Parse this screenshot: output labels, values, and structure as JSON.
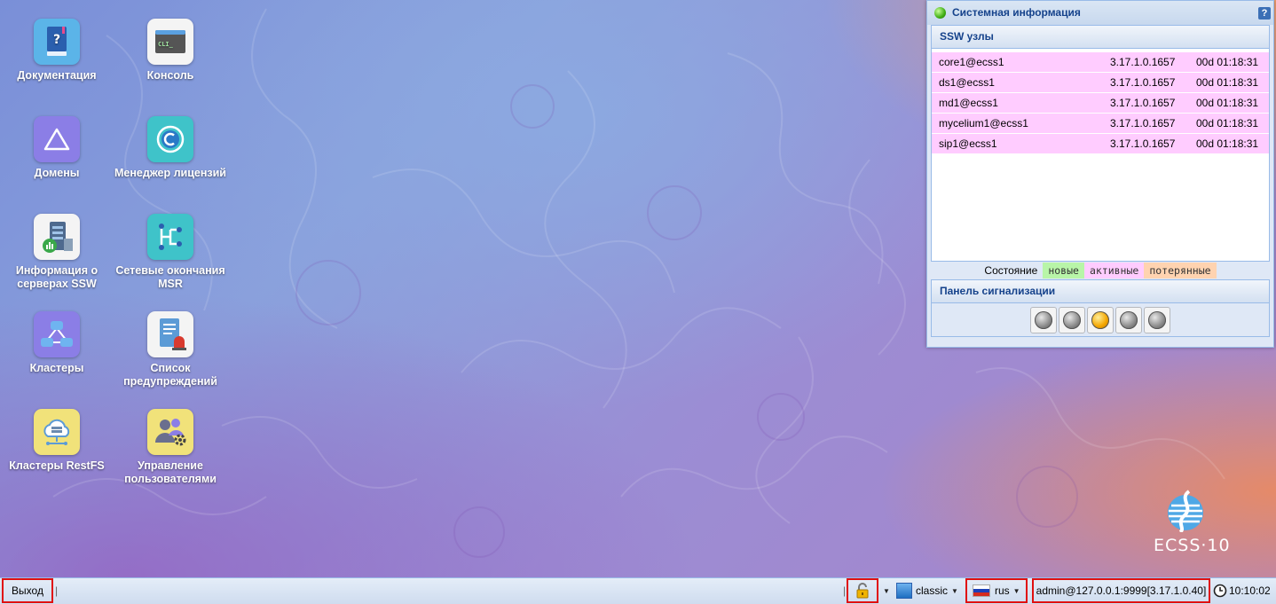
{
  "desktop_icons": [
    {
      "id": "docs",
      "label": "Документация",
      "icon": "book-help-icon"
    },
    {
      "id": "console",
      "label": "Консоль",
      "icon": "cli-console-icon"
    },
    {
      "id": "domains",
      "label": "Домены",
      "icon": "triangle-icon"
    },
    {
      "id": "license",
      "label": "Менеджер лицензий",
      "icon": "copyright-icon"
    },
    {
      "id": "serverinfo",
      "label": "Информация о серверах SSW",
      "icon": "server-stats-icon"
    },
    {
      "id": "msr",
      "label": "Сетевые окончания MSR",
      "icon": "network-endpoints-icon"
    },
    {
      "id": "clusters",
      "label": "Кластеры",
      "icon": "cluster-icon"
    },
    {
      "id": "alerts",
      "label": "Список предупреждений",
      "icon": "alarm-list-icon"
    },
    {
      "id": "restfs",
      "label": "Кластеры RestFS",
      "icon": "cloud-storage-icon"
    },
    {
      "id": "users",
      "label": "Управление пользователями",
      "icon": "users-gear-icon"
    }
  ],
  "sysinfo": {
    "title": "Системная информация",
    "help": "?",
    "nodes_header": "SSW узлы",
    "nodes": [
      {
        "name": "core1@ecss1",
        "version": "3.17.1.0.1657",
        "uptime": "00d 01:18:31"
      },
      {
        "name": "ds1@ecss1",
        "version": "3.17.1.0.1657",
        "uptime": "00d 01:18:31"
      },
      {
        "name": "md1@ecss1",
        "version": "3.17.1.0.1657",
        "uptime": "00d 01:18:31"
      },
      {
        "name": "mycelium1@ecss1",
        "version": "3.17.1.0.1657",
        "uptime": "00d 01:18:31"
      },
      {
        "name": "sip1@ecss1",
        "version": "3.17.1.0.1657",
        "uptime": "00d 01:18:31"
      }
    ],
    "legend": {
      "label": "Состояние",
      "states": [
        {
          "text": "новые",
          "color": "#b8f5a8"
        },
        {
          "text": "активные",
          "color": "#ffccff"
        },
        {
          "text": "потерянные",
          "color": "#ffd3b0"
        }
      ]
    },
    "alarm_header": "Панель сигнализации",
    "alarm_lamps": [
      false,
      false,
      true,
      false,
      false
    ]
  },
  "logo": {
    "text": "ECSS·10"
  },
  "taskbar": {
    "logout": "Выход",
    "theme": "classic",
    "language": "rus",
    "connection": "admin@127.0.0.1:9999[3.17.1.0.40]",
    "clock": "10:10:02"
  },
  "colors": {
    "accent": "#15428b",
    "highlight": "#e01010"
  }
}
